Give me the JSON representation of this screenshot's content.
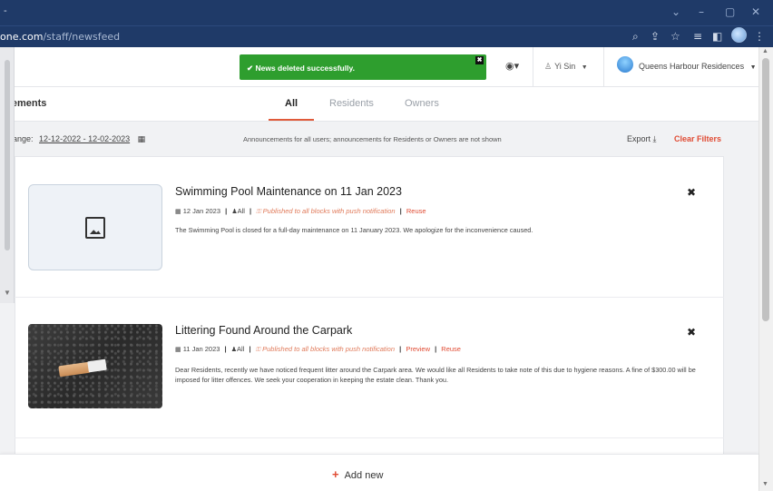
{
  "browser": {
    "url_host": "one.com",
    "url_path": "/staff/newsfeed"
  },
  "toast": {
    "message": "✔ News deleted successfully.",
    "close": "✖"
  },
  "header": {
    "user_name": "Yi Sin",
    "estate_name": "Queens Harbour Residences"
  },
  "page": {
    "section_title": "ncements",
    "tabs": [
      {
        "label": "All",
        "active": true
      },
      {
        "label": "Residents",
        "active": false
      },
      {
        "label": "Owners",
        "active": false
      }
    ]
  },
  "filters": {
    "date_label": "e Range:",
    "date_value": "12-12-2022 - 12-02-2023",
    "info": "Announcements for all users; announcements for Residents or Owners are not shown",
    "export_label": "Export",
    "clear_label": "Clear Filters"
  },
  "posts": [
    {
      "title": "Swimming Pool Maintenance on 11 Jan 2023",
      "date": "12 Jan 2023",
      "audience": "All",
      "status": "Published to all blocks with push notification",
      "links": [
        "Reuse"
      ],
      "body": "The Swimming Pool is closed for a full-day maintenance on 11 January 2023. We apologize for the inconvenience caused."
    },
    {
      "title": "Littering Found Around the Carpark",
      "date": "11 Jan 2023",
      "audience": "All",
      "status": "Published to all blocks with push notification",
      "links": [
        "Preview",
        "Reuse"
      ],
      "body": "Dear Residents, recently we have noticed frequent litter around the Carpark area. We would like all Residents to take note of this due to hygiene reasons. A fine of $300.00 will be imposed for litter offences. We seek your cooperation in keeping the estate clean. Thank you."
    }
  ],
  "footer": {
    "add_new_label": "Add new"
  },
  "colors": {
    "accent": "#e04b33",
    "toast": "#2e9e2e",
    "chrome": "#1f3a68"
  }
}
